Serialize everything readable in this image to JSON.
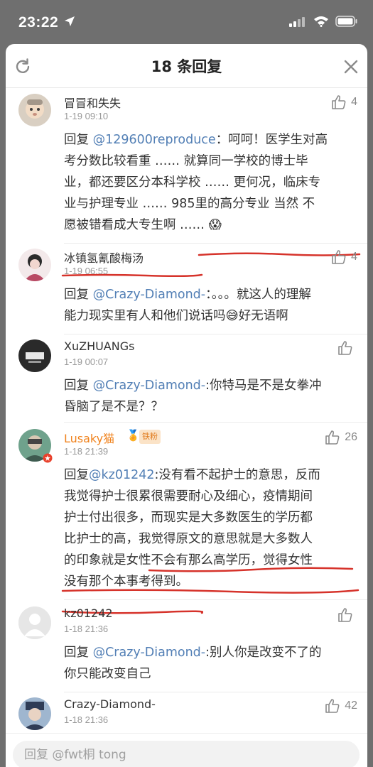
{
  "status": {
    "time": "23:22"
  },
  "header": {
    "title": "18 条回复"
  },
  "comments": [
    {
      "name": "冒冒和失失",
      "time": "1-19 09:10",
      "likes": "4",
      "body_lines": [
        [
          "回复",
          "@129600reproduce",
          "：呵呵！医学生对高"
        ],
        [
          "考分数比较看重 …… 就算同一学校的博士毕"
        ],
        [
          "业，都还要区分本科学校 …… 更何况，临床专"
        ],
        [
          "业与护理专业 …… 985里的高分专业 当然 不"
        ],
        [
          "愿被错看成大专生啊 ……",
          " 😱"
        ]
      ]
    },
    {
      "name": "冰镇氢氰酸梅汤",
      "time": "1-19 06:55",
      "likes": "4",
      "body_lines": [
        [
          "回复 ",
          "@Crazy-Diamond-",
          "：。。。就这人的理解"
        ],
        [
          "能力现实里有人和他们说话吗",
          "😅",
          "好无语啊"
        ]
      ]
    },
    {
      "name": "XuZHUANGs",
      "time": "1-19 00:07",
      "likes": "",
      "body_lines": [
        [
          "回复 ",
          "@Crazy-Diamond-",
          ":你特马是不是女拳冲"
        ],
        [
          "昏脑了是不是？？"
        ]
      ]
    },
    {
      "name": "Lusaky猫",
      "badge": "铁粉",
      "time": "1-18 21:39",
      "likes": "26",
      "body_lines": [
        [
          "回复",
          "@kz01242",
          ":没有看不起护士的意思，反而"
        ],
        [
          "我觉得护士很累很需要耐心及细心，疫情期间"
        ],
        [
          "护士付出很多，而现实是大多数医生的学历都"
        ],
        [
          "比护士的高，我觉得原文的意思就是大多数人"
        ],
        [
          "的印象就是女性不会有那么高学历，觉得女性"
        ],
        [
          "没有那个本事考得到。"
        ]
      ]
    },
    {
      "name": "kz01242",
      "time": "1-18 21:36",
      "likes": "",
      "body_lines": [
        [
          "回复 ",
          "@Crazy-Diamond-",
          ":别人你是改变不了的"
        ],
        [
          "你只能改变自己"
        ]
      ]
    },
    {
      "name": "Crazy-Diamond-",
      "time": "1-18 21:36",
      "likes": "42",
      "body_lines": []
    }
  ],
  "input": {
    "placeholder": "回复 @fwt桐 tong"
  }
}
